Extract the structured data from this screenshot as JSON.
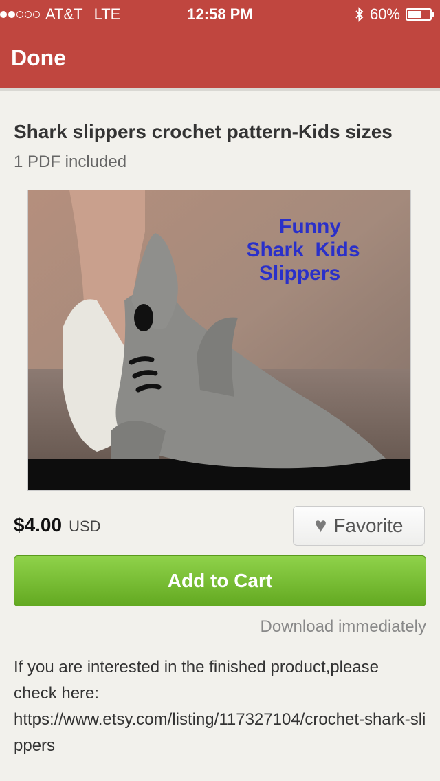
{
  "status_bar": {
    "carrier": "AT&T",
    "network": "LTE",
    "time": "12:58 PM",
    "battery": "60%",
    "signal_bars": 2,
    "signal_total": 5,
    "battery_level": 0.6
  },
  "nav": {
    "done_label": "Done"
  },
  "listing": {
    "title": "Shark slippers crochet pattern-Kids sizes",
    "subtitle": "1 PDF included",
    "image_text_lines": [
      "Funny",
      "Shark  Kids",
      "Slippers"
    ],
    "price": "$4.00",
    "currency": "USD",
    "favorite_label": "Favorite",
    "add_to_cart_label": "Add to Cart",
    "download_note": "Download immediately",
    "description": [
      "If you are interested in the finished product,please check here:",
      "https://www.etsy.com/listing/117327104/crochet-shark-slippers"
    ]
  },
  "colors": {
    "header": "#c0463f",
    "cart_button": "#7bc13a",
    "background": "#f2f1ec"
  }
}
